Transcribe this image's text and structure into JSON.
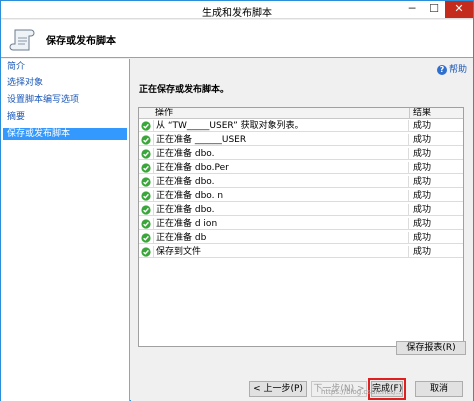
{
  "window": {
    "title": "生成和发布脚本",
    "minimize": "─",
    "maximize": "☐",
    "close": "✕"
  },
  "header": {
    "title": "保存或发布脚本",
    "icon": "script-scroll-icon"
  },
  "sidebar": {
    "items": [
      {
        "label": "简介",
        "active": false
      },
      {
        "label": "选择对象",
        "active": false
      },
      {
        "label": "设置脚本编写选项",
        "active": false
      },
      {
        "label": "摘要",
        "active": false
      },
      {
        "label": "保存或发布脚本",
        "active": true
      }
    ]
  },
  "main": {
    "help_label": "帮助",
    "status": "正在保存或发布脚本。",
    "table": {
      "columns": [
        "操作",
        "结果"
      ],
      "rows": [
        {
          "op": "从 “TW_____USER” 获取对象列表。",
          "result": "成功"
        },
        {
          "op": "正在准备 ______USER",
          "result": "成功"
        },
        {
          "op": "正在准备 dbo.",
          "result": "成功"
        },
        {
          "op": "正在准备 dbo.Per",
          "result": "成功"
        },
        {
          "op": "正在准备 dbo.",
          "result": "成功"
        },
        {
          "op": "正在准备 dbo.                    n",
          "result": "成功"
        },
        {
          "op": "正在准备 dbo.",
          "result": "成功"
        },
        {
          "op": "正在准备 d                       ion",
          "result": "成功"
        },
        {
          "op": "正在准备 db",
          "result": "成功"
        },
        {
          "op": "保存到文件",
          "result": "成功"
        }
      ]
    },
    "save_report": "保存报表(R)"
  },
  "buttons": {
    "back": "< 上一步(P)",
    "next": "下一步(N) >",
    "finish": "完成(F)",
    "cancel": "取消"
  },
  "watermark": "https://blog.csdn.net/...",
  "colors": {
    "accent": "#3399ff",
    "success": "#3aa53a",
    "highlight_border": "#e02020"
  }
}
